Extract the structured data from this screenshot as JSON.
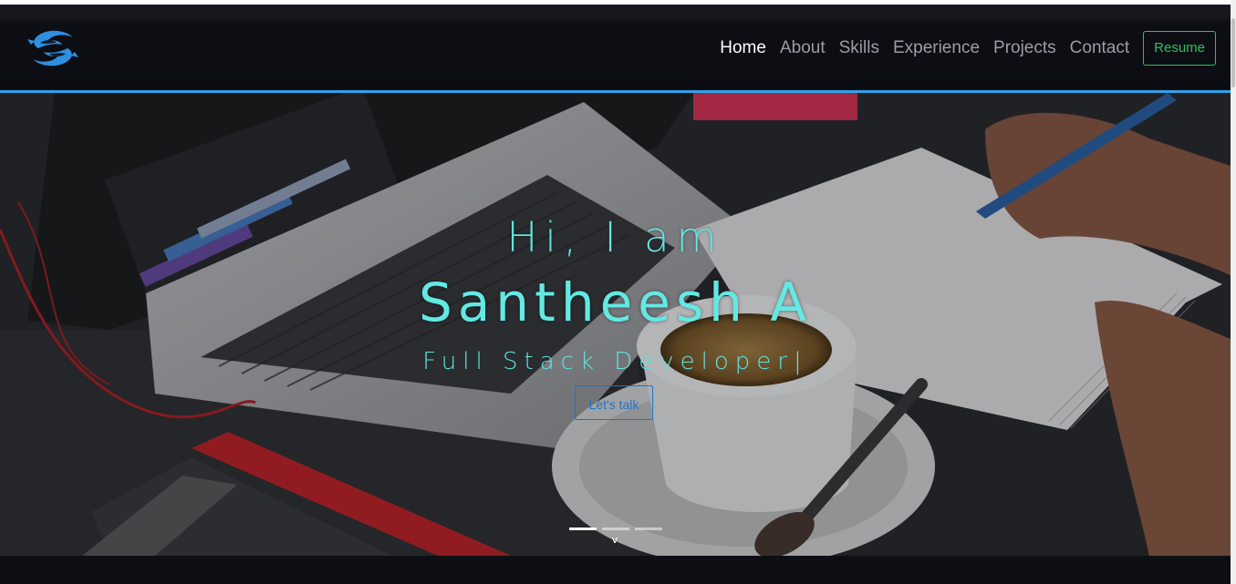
{
  "navbar": {
    "logo_icon": "fish-swirl-logo-icon",
    "links": [
      {
        "label": "Home",
        "active": true
      },
      {
        "label": "About",
        "active": false
      },
      {
        "label": "Skills",
        "active": false
      },
      {
        "label": "Experience",
        "active": false
      },
      {
        "label": "Projects",
        "active": false
      },
      {
        "label": "Contact",
        "active": false
      }
    ],
    "resume_label": "Resume"
  },
  "hero": {
    "greeting": "Hi, I am",
    "name": "Santheesh A",
    "role": "Full Stack Developer|",
    "cta_label": "Let's talk",
    "slide_count": 3,
    "active_slide": 1,
    "scroll_glyph": "v",
    "background_icon": "desk-laptop-coffee-photo"
  },
  "colors": {
    "accent_cyan": "#63e3df",
    "nav_border": "#2fa2e8",
    "resume_green": "#2ec15e",
    "cta_blue": "#1f73c9",
    "nav_bg": "#0b0d13"
  }
}
